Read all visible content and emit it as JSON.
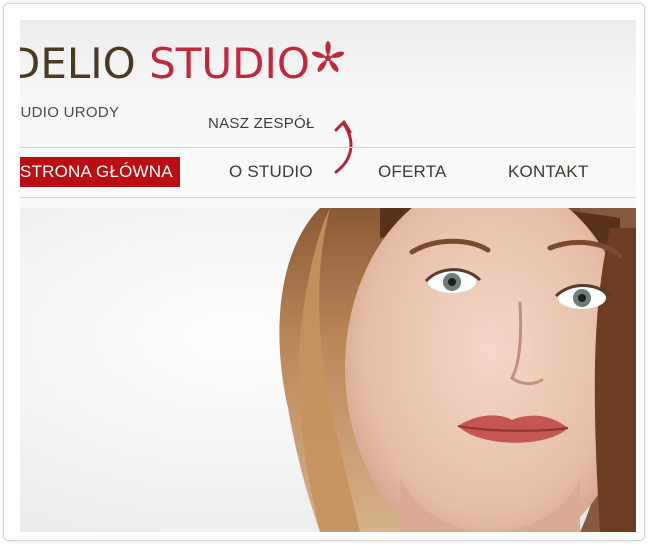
{
  "site": {
    "logo_part1": "DELIO",
    "logo_part2": "STUDIO",
    "tagline": "TUDIO URODY"
  },
  "subnav": {
    "link_label": "NASZ ZESPÓŁ"
  },
  "nav": {
    "items": [
      {
        "label": "STRONA GŁÓWNA",
        "active": true
      },
      {
        "label": "O STUDIO",
        "active": false
      },
      {
        "label": "OFERTA",
        "active": false
      },
      {
        "label": "KONTAKT",
        "active": false
      }
    ]
  },
  "hero": {
    "image_subject": "woman-portrait"
  },
  "colors": {
    "brand_dark": "#4a3a22",
    "brand_red": "#c0283c",
    "nav_active_bg": "#b80e14"
  },
  "icons": {
    "logo_mark": "flower-icon",
    "pointer": "curved-arrow-icon"
  }
}
